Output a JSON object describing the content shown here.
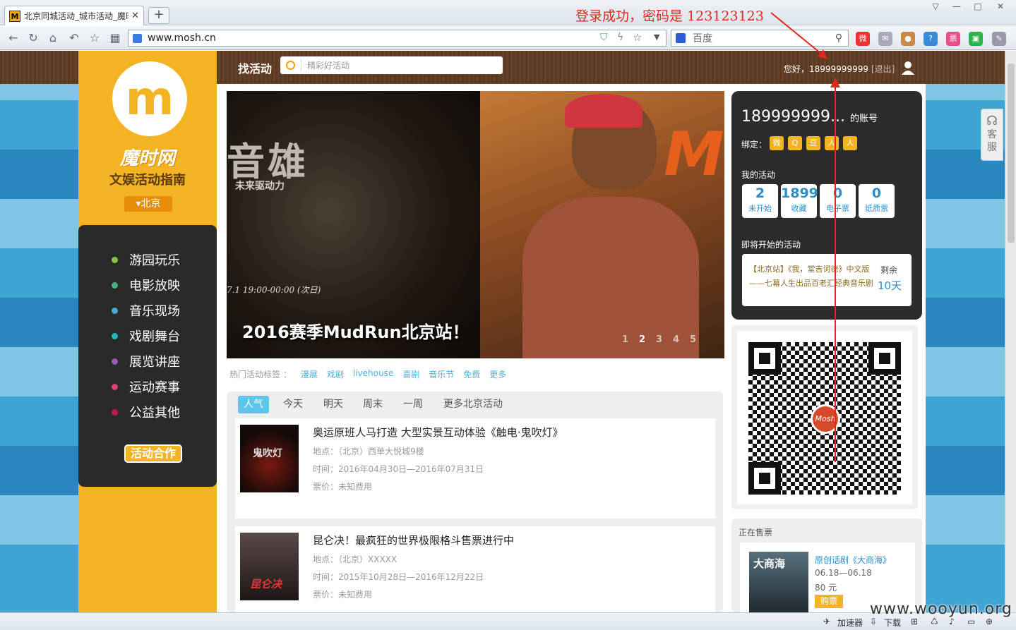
{
  "browser": {
    "tab_title": "北京同城活动_城市活动_魔时",
    "url": "www.mosh.cn",
    "search_engine": "百度",
    "new_tab": "+",
    "tab_close": "✕"
  },
  "annotation": {
    "text": "登录成功，密码是 123123123",
    "color": "#e0281e"
  },
  "header": {
    "find_label": "找活动",
    "search_placeholder": "精彩好活动",
    "greeting": "您好，18999999999",
    "logout": "[退出]"
  },
  "sidebar": {
    "logo_text": "m",
    "site_name": "魔时网",
    "slogan": "文娱活动指南",
    "city": "▾北京",
    "categories": [
      {
        "label": "游园玩乐",
        "color": "#8bc34a"
      },
      {
        "label": "电影放映",
        "color": "#4caf82"
      },
      {
        "label": "音乐现场",
        "color": "#4aa8d8"
      },
      {
        "label": "戏剧舞台",
        "color": "#26b3c4"
      },
      {
        "label": "展览讲座",
        "color": "#9c5ab8"
      },
      {
        "label": "运动赛事",
        "color": "#e0407a"
      },
      {
        "label": "公益其他",
        "color": "#c2185b"
      }
    ],
    "cooperation": "活动合作"
  },
  "banner": {
    "hero_text": "音雄",
    "sub_text": "未来驱动力",
    "date_text": "7.1  19:00-00:00 (次日)",
    "mud_text": "MU",
    "caption": "2016赛季MudRun北京站！",
    "pages": [
      "1",
      "2",
      "3",
      "4",
      "5"
    ],
    "active_page": "2"
  },
  "hot_tags": {
    "label": "热门活动标签 ：",
    "tags": [
      "漫展",
      "戏剧",
      "livehouse",
      "喜剧",
      "音乐节",
      "免费",
      "更多"
    ]
  },
  "list_tabs": [
    "人气",
    "今天",
    "明天",
    "周末",
    "一周",
    "更多北京活动"
  ],
  "events": [
    {
      "title": "奥运原班人马打造 大型实景互动体验《触电·鬼吹灯》",
      "location": "地点：（北京）西单大悦城9楼",
      "time": "时间：2016年04月30日—2016年07月31日",
      "price": "票价：未知费用",
      "img_text": "鬼吹灯"
    },
    {
      "title": "昆仑决！最疯狂的世界极限格斗售票进行中",
      "location": "地点：（北京）XXXXX",
      "time": "时间：2015年10月28日—2016年12月22日",
      "price": "票价：未知费用",
      "img_text": "昆仑决"
    }
  ],
  "account": {
    "name": "189999999...",
    "suffix": "的账号",
    "bind_label": "绑定：",
    "bind_icons": [
      "微",
      "Q",
      "豆",
      "人",
      "人"
    ],
    "my_label": "我的活动",
    "stats": [
      {
        "num": "2",
        "label": "未开始"
      },
      {
        "num": "1899",
        "label": "收藏"
      },
      {
        "num": "0",
        "label": "电子票"
      },
      {
        "num": "0",
        "label": "纸质票"
      }
    ],
    "soon_label": "即将开始的活动",
    "soon_event": "【北京站】《我，堂吉诃德》中文版——七幕人生出品百老汇经典音乐剧",
    "remain_label": "剩余",
    "remain_days": "10天"
  },
  "qr": {
    "logo_text": "Mosh"
  },
  "on_sale": {
    "label": "正在售票",
    "img_text": "大商海",
    "title": "原创话剧《大商海》",
    "date": "06.18—06.18",
    "price": "80 元",
    "buy": "购票"
  },
  "customer_service": "客服",
  "status": {
    "accelerator": "加速器",
    "download": "下载"
  },
  "watermark": "www.wooyun.org"
}
